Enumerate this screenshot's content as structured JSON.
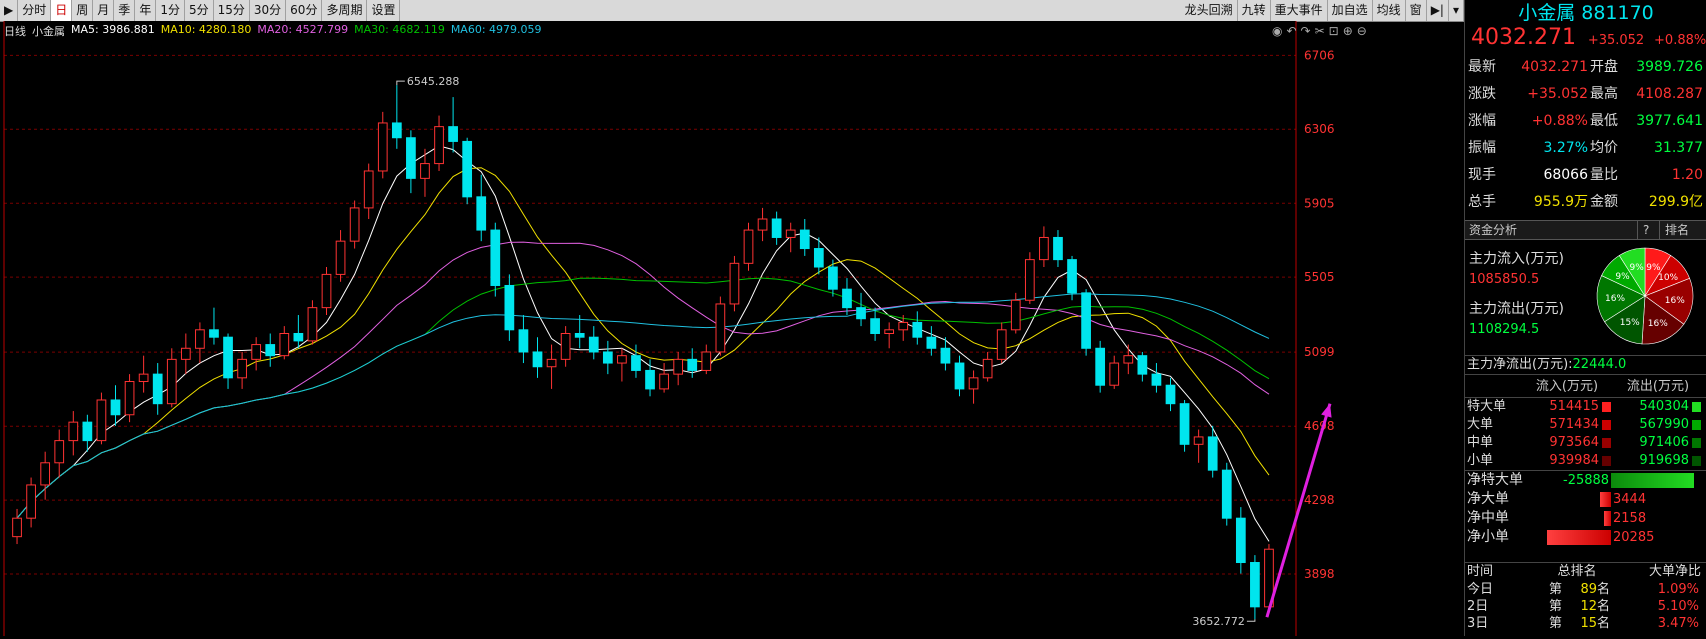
{
  "toolbar": {
    "left": [
      "分时",
      "日",
      "周",
      "月",
      "季",
      "年",
      "1分",
      "5分",
      "15分",
      "30分",
      "60分",
      "多周期",
      "设置"
    ],
    "active": "日",
    "right": [
      "龙头回溯",
      "九转",
      "重大事件",
      "加自选",
      "均线",
      "窗"
    ]
  },
  "info": {
    "period": "日线",
    "name": "小金属",
    "ma": [
      {
        "label": "MA5: 3986.881",
        "color": "#ffffff"
      },
      {
        "label": "MA10: 4280.180",
        "color": "#f0e000"
      },
      {
        "label": "MA20: 4527.799",
        "color": "#e060e0"
      },
      {
        "label": "MA30: 4682.119",
        "color": "#00c000"
      },
      {
        "label": "MA60: 4979.059",
        "color": "#20c0e0"
      }
    ]
  },
  "colors": {
    "up": "#ff3333",
    "down": "#00e5ee",
    "grid": "#7a0000",
    "axis": "#bb0000",
    "arrow": "#e020e0"
  },
  "chart_data": {
    "type": "candlestick",
    "y_ticks": [
      6706,
      6306,
      5905,
      5505,
      5099,
      4698,
      4298,
      3898
    ],
    "ylim": [
      3600,
      6800
    ],
    "annotations": {
      "high": "6545.288",
      "low": "3652.772"
    },
    "ohlc": [
      [
        4100,
        4250,
        4060,
        4200
      ],
      [
        4200,
        4420,
        4150,
        4380
      ],
      [
        4380,
        4560,
        4300,
        4500
      ],
      [
        4500,
        4680,
        4420,
        4620
      ],
      [
        4620,
        4780,
        4540,
        4720
      ],
      [
        4720,
        4760,
        4560,
        4620
      ],
      [
        4620,
        4880,
        4600,
        4840
      ],
      [
        4840,
        4920,
        4700,
        4760
      ],
      [
        4760,
        4980,
        4720,
        4940
      ],
      [
        4940,
        5080,
        4880,
        4980
      ],
      [
        4980,
        5040,
        4760,
        4820
      ],
      [
        4820,
        5120,
        4800,
        5060
      ],
      [
        5060,
        5200,
        4980,
        5120
      ],
      [
        5120,
        5260,
        5040,
        5220
      ],
      [
        5220,
        5340,
        5140,
        5180
      ],
      [
        5180,
        5200,
        4900,
        4960
      ],
      [
        4960,
        5100,
        4900,
        5060
      ],
      [
        5060,
        5180,
        5000,
        5140
      ],
      [
        5140,
        5200,
        5020,
        5080
      ],
      [
        5080,
        5240,
        5060,
        5200
      ],
      [
        5200,
        5300,
        5120,
        5160
      ],
      [
        5160,
        5380,
        5140,
        5340
      ],
      [
        5340,
        5560,
        5300,
        5520
      ],
      [
        5520,
        5760,
        5480,
        5700
      ],
      [
        5700,
        5920,
        5660,
        5880
      ],
      [
        5880,
        6120,
        5820,
        6080
      ],
      [
        6080,
        6400,
        6040,
        6340
      ],
      [
        6340,
        6545,
        6200,
        6260
      ],
      [
        6260,
        6300,
        5960,
        6040
      ],
      [
        6040,
        6200,
        5940,
        6120
      ],
      [
        6120,
        6380,
        6080,
        6320
      ],
      [
        6320,
        6480,
        6180,
        6240
      ],
      [
        6240,
        6260,
        5900,
        5940
      ],
      [
        5940,
        6060,
        5700,
        5760
      ],
      [
        5760,
        5800,
        5400,
        5460
      ],
      [
        5460,
        5520,
        5160,
        5220
      ],
      [
        5220,
        5300,
        5040,
        5100
      ],
      [
        5100,
        5180,
        4960,
        5020
      ],
      [
        5020,
        5140,
        4900,
        5060
      ],
      [
        5060,
        5240,
        5020,
        5200
      ],
      [
        5200,
        5300,
        5120,
        5180
      ],
      [
        5180,
        5240,
        5060,
        5100
      ],
      [
        5100,
        5160,
        4980,
        5040
      ],
      [
        5040,
        5120,
        4940,
        5080
      ],
      [
        5080,
        5140,
        4960,
        5000
      ],
      [
        5000,
        5060,
        4860,
        4900
      ],
      [
        4900,
        5040,
        4880,
        4980
      ],
      [
        4980,
        5100,
        4920,
        5060
      ],
      [
        5060,
        5120,
        4960,
        5000
      ],
      [
        5000,
        5140,
        4980,
        5100
      ],
      [
        5100,
        5400,
        5080,
        5360
      ],
      [
        5360,
        5620,
        5320,
        5580
      ],
      [
        5580,
        5800,
        5540,
        5760
      ],
      [
        5760,
        5880,
        5700,
        5820
      ],
      [
        5820,
        5860,
        5680,
        5720
      ],
      [
        5720,
        5800,
        5640,
        5760
      ],
      [
        5760,
        5820,
        5620,
        5660
      ],
      [
        5660,
        5720,
        5520,
        5560
      ],
      [
        5560,
        5600,
        5400,
        5440
      ],
      [
        5440,
        5500,
        5300,
        5340
      ],
      [
        5340,
        5420,
        5240,
        5280
      ],
      [
        5280,
        5340,
        5160,
        5200
      ],
      [
        5200,
        5260,
        5120,
        5220
      ],
      [
        5220,
        5300,
        5160,
        5260
      ],
      [
        5260,
        5320,
        5140,
        5180
      ],
      [
        5180,
        5240,
        5080,
        5120
      ],
      [
        5120,
        5180,
        5000,
        5040
      ],
      [
        5040,
        5080,
        4860,
        4900
      ],
      [
        4900,
        5000,
        4820,
        4960
      ],
      [
        4960,
        5100,
        4940,
        5060
      ],
      [
        5060,
        5260,
        5040,
        5220
      ],
      [
        5220,
        5420,
        5200,
        5380
      ],
      [
        5380,
        5640,
        5360,
        5600
      ],
      [
        5600,
        5780,
        5560,
        5720
      ],
      [
        5720,
        5760,
        5560,
        5600
      ],
      [
        5600,
        5620,
        5380,
        5420
      ],
      [
        5420,
        5440,
        5080,
        5120
      ],
      [
        5120,
        5160,
        4880,
        4920
      ],
      [
        4920,
        5080,
        4900,
        5040
      ],
      [
        5040,
        5140,
        4980,
        5080
      ],
      [
        5080,
        5100,
        4940,
        4980
      ],
      [
        4980,
        5040,
        4880,
        4920
      ],
      [
        4920,
        4960,
        4780,
        4820
      ],
      [
        4820,
        4840,
        4560,
        4600
      ],
      [
        4600,
        4680,
        4500,
        4640
      ],
      [
        4640,
        4700,
        4420,
        4460
      ],
      [
        4460,
        4500,
        4160,
        4200
      ],
      [
        4200,
        4260,
        3900,
        3960
      ],
      [
        3960,
        4000,
        3653,
        3720
      ],
      [
        3720,
        4060,
        3700,
        4032
      ]
    ]
  },
  "panel": {
    "title": "小金属 881170",
    "price": "4032.271",
    "change": "+35.052",
    "pct": "+0.88%",
    "rows": [
      {
        "l1": "最新",
        "v1": "4032.271",
        "c1": "#ff3333",
        "l2": "开盘",
        "v2": "3989.726",
        "c2": "#00ff40"
      },
      {
        "l1": "涨跌",
        "v1": "+35.052",
        "c1": "#ff3333",
        "l2": "最高",
        "v2": "4108.287",
        "c2": "#ff3333"
      },
      {
        "l1": "涨幅",
        "v1": "+0.88%",
        "c1": "#ff3333",
        "l2": "最低",
        "v2": "3977.641",
        "c2": "#00ff40"
      },
      {
        "l1": "振幅",
        "v1": "3.27%",
        "c1": "#00e5ee",
        "l2": "均价",
        "v2": "31.377",
        "c2": "#00ff40"
      },
      {
        "l1": "现手",
        "v1": "68066",
        "c1": "#ffffff",
        "l2": "量比",
        "v2": "1.20",
        "c2": "#ff3333"
      },
      {
        "l1": "总手",
        "v1": "955.9万",
        "c1": "#f0e000",
        "l2": "金额",
        "v2": "299.9亿",
        "c2": "#f0e000"
      }
    ],
    "section": "资金分析",
    "section_btn1": "?",
    "section_btn2": "排名",
    "inflow_label": "主力流入(万元)",
    "inflow_value": "1085850.5",
    "outflow_label": "主力流出(万元)",
    "outflow_value": "1108294.5",
    "net_label": "主力净流出(万元):",
    "net_value": "22444.0",
    "pie": [
      {
        "label": "9%",
        "color": "#ff1a1a",
        "pct": 9
      },
      {
        "label": "10%",
        "color": "#cc0000",
        "pct": 10
      },
      {
        "label": "16%",
        "color": "#990000",
        "pct": 16
      },
      {
        "label": "16%",
        "color": "#660000",
        "pct": 16
      },
      {
        "label": "15%",
        "color": "#005500",
        "pct": 15
      },
      {
        "label": "16%",
        "color": "#007700",
        "pct": 16
      },
      {
        "label": "9%",
        "color": "#00aa00",
        "pct": 9
      },
      {
        "label": "9%",
        "color": "#22dd22",
        "pct": 9
      }
    ],
    "vol_head": {
      "in": "流入(万元)",
      "out": "流出(万元)"
    },
    "vol_rows": [
      {
        "name": "特大单",
        "in": "514415",
        "out": "540304"
      },
      {
        "name": "大单",
        "in": "571434",
        "out": "567990"
      },
      {
        "name": "中单",
        "in": "973564",
        "out": "971406"
      },
      {
        "name": "小单",
        "in": "939984",
        "out": "919698"
      }
    ],
    "net_rows": [
      {
        "name": "净特大单",
        "value": "-25888",
        "neg": true,
        "frac": 0.9
      },
      {
        "name": "净大单",
        "value": "3444",
        "neg": false,
        "frac": 0.12
      },
      {
        "name": "净中单",
        "value": "2158",
        "neg": false,
        "frac": 0.08
      },
      {
        "name": "净小单",
        "value": "20285",
        "neg": false,
        "frac": 0.7
      }
    ],
    "rank_head": {
      "c1": "时间",
      "c2": "总排名",
      "c3": "大单净比"
    },
    "rank_rows": [
      {
        "t": "今日",
        "p": "第",
        "n": "89",
        "u": "名",
        "v": "1.09%"
      },
      {
        "t": "2日",
        "p": "第",
        "n": "12",
        "u": "名",
        "v": "5.10%"
      },
      {
        "t": "3日",
        "p": "第",
        "n": "15",
        "u": "名",
        "v": "3.47%"
      }
    ]
  }
}
